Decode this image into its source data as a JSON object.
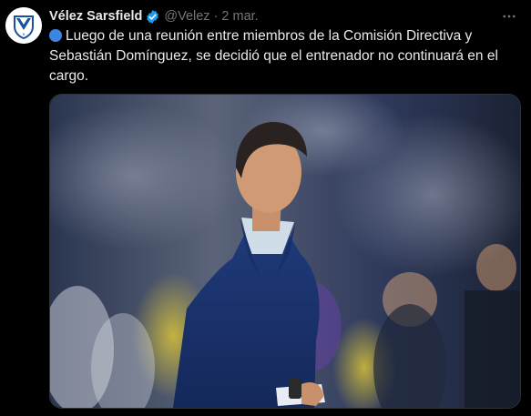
{
  "tweet": {
    "author_name": "Vélez Sarsfield",
    "handle": "@Velez",
    "separator": "·",
    "date": "2 mar.",
    "verified_color": "#1d9bf0",
    "body_text": "Luego de una reunión entre miembros de la Comisión Directiva y Sebastián Domínguez, se decidió que el entrenador no continuará en el cargo.",
    "bullet_icon": "blue-circle-icon",
    "menu_icon": "more-horizontal-icon"
  }
}
